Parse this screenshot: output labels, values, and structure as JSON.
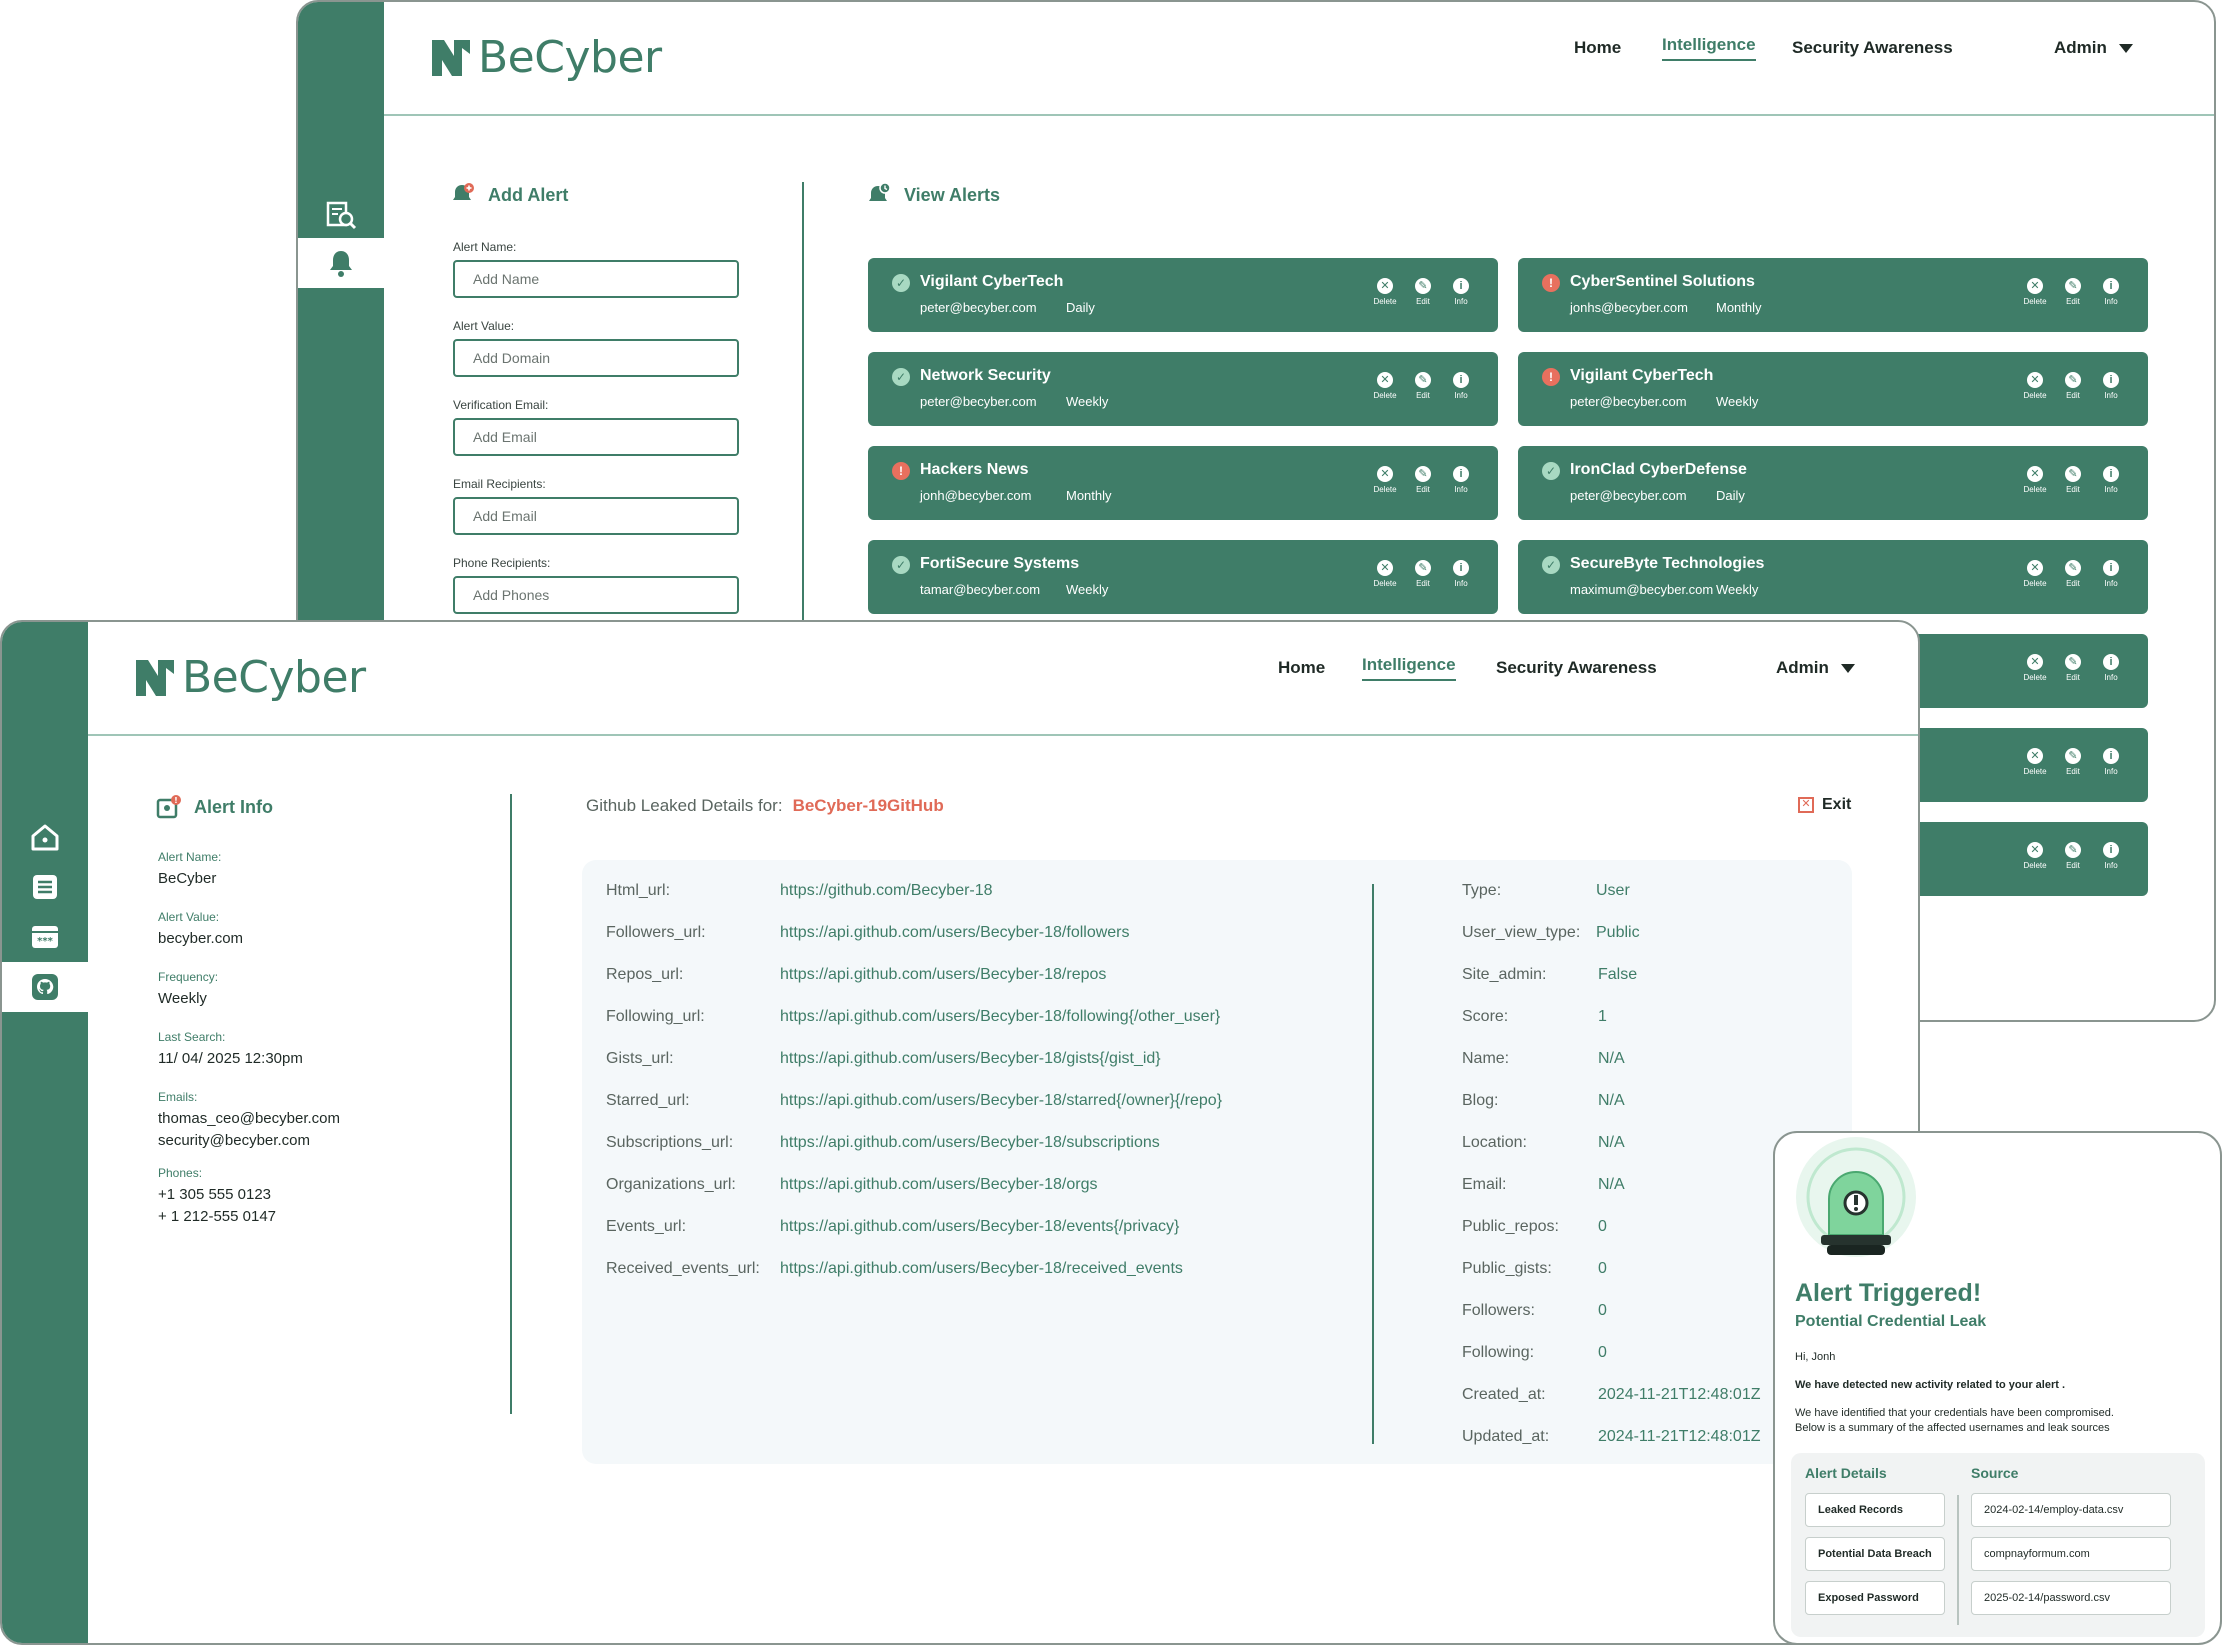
{
  "brand": {
    "logo_text": "BeCyber",
    "color_primary": "#3f7d68",
    "color_alert": "#e06a57"
  },
  "nav": {
    "home": "Home",
    "intelligence": "Intelligence",
    "security_awareness": "Security Awareness",
    "admin": "Admin"
  },
  "add_alert": {
    "title": "Add Alert",
    "fields": [
      {
        "label": "Alert Name:",
        "placeholder": "Add Name"
      },
      {
        "label": "Alert Value:",
        "placeholder": "Add Domain"
      },
      {
        "label": "Verification Email:",
        "placeholder": "Add Email"
      },
      {
        "label": "Email Recipients:",
        "placeholder": "Add Email"
      },
      {
        "label": "Phone Recipients:",
        "placeholder": "Add Phones"
      }
    ]
  },
  "view_alerts": {
    "title": "View Alerts",
    "action_labels": {
      "delete": "Delete",
      "edit": "Edit",
      "info": "Info"
    },
    "cards": [
      {
        "name": "Vigilant CyberTech",
        "email": "peter@becyber.com",
        "freq": "Daily",
        "status": "ok"
      },
      {
        "name": "CyberSentinel Solutions",
        "email": "jonhs@becyber.com",
        "freq": "Monthly",
        "status": "warn"
      },
      {
        "name": "Network Security",
        "email": "peter@becyber.com",
        "freq": "Weekly",
        "status": "ok"
      },
      {
        "name": "Vigilant CyberTech",
        "email": "peter@becyber.com",
        "freq": "Weekly",
        "status": "warn"
      },
      {
        "name": "Hackers News",
        "email": "jonh@becyber.com",
        "freq": "Monthly",
        "status": "warn"
      },
      {
        "name": "IronClad CyberDefense",
        "email": "peter@becyber.com",
        "freq": "Daily",
        "status": "ok"
      },
      {
        "name": "FortiSecure Systems",
        "email": "tamar@becyber.com",
        "freq": "Weekly",
        "status": "ok"
      },
      {
        "name": "SecureByte Technologies",
        "email": "maximum@becyber.com",
        "freq": "Weekly",
        "status": "ok"
      }
    ]
  },
  "alert_info": {
    "title": "Alert Info",
    "name_label": "Alert Name:",
    "name": "BeCyber",
    "value_label": "Alert Value:",
    "value": "becyber.com",
    "freq_label": "Frequency:",
    "freq": "Weekly",
    "last_label": "Last Search:",
    "last": "11/ 04/ 2025 12:30pm",
    "emails_label": "Emails:",
    "email1": "thomas_ceo@becyber.com",
    "email2": "security@becyber.com",
    "phones_label": "Phones:",
    "phone1": "+1 305 555 0123",
    "phone2": "+ 1 212-555 0147"
  },
  "github": {
    "header": "Github Leaked Details for:",
    "target": "BeCyber-19GitHub",
    "exit": "Exit",
    "left": [
      {
        "k": "Html_url:",
        "v": "https://github.com/Becyber-18"
      },
      {
        "k": "Followers_url:",
        "v": "https://api.github.com/users/Becyber-18/followers"
      },
      {
        "k": "Repos_url:",
        "v": "https://api.github.com/users/Becyber-18/repos"
      },
      {
        "k": "Following_url:",
        "v": "https://api.github.com/users/Becyber-18/following{/other_user}"
      },
      {
        "k": "Gists_url:",
        "v": "https://api.github.com/users/Becyber-18/gists{/gist_id}"
      },
      {
        "k": "Starred_url:",
        "v": "https://api.github.com/users/Becyber-18/starred{/owner}{/repo}"
      },
      {
        "k": "Subscriptions_url:",
        "v": "https://api.github.com/users/Becyber-18/subscriptions"
      },
      {
        "k": "Organizations_url:",
        "v": "https://api.github.com/users/Becyber-18/orgs"
      },
      {
        "k": "Events_url:",
        "v": "https://api.github.com/users/Becyber-18/events{/privacy}"
      },
      {
        "k": "Received_events_url:",
        "v": "https://api.github.com/users/Becyber-18/received_events"
      }
    ],
    "right": [
      {
        "k": "Type:",
        "v": "User"
      },
      {
        "k": "User_view_type:",
        "v": "Public"
      },
      {
        "k": "Site_admin:",
        "v": "False"
      },
      {
        "k": "Score:",
        "v": "1"
      },
      {
        "k": "Name:",
        "v": "N/A"
      },
      {
        "k": "Blog:",
        "v": "N/A"
      },
      {
        "k": "Location:",
        "v": "N/A"
      },
      {
        "k": "Email:",
        "v": "N/A"
      },
      {
        "k": "Public_repos:",
        "v": "0"
      },
      {
        "k": "Public_gists:",
        "v": "0"
      },
      {
        "k": "Followers:",
        "v": "0"
      },
      {
        "k": "Following:",
        "v": "0"
      },
      {
        "k": "Created_at:",
        "v": "2024-11-21T12:48:01Z"
      },
      {
        "k": "Updated_at:",
        "v": "2024-11-21T12:48:01Z"
      }
    ]
  },
  "popup": {
    "title": "Alert Triggered!",
    "subtitle": "Potential Credential Leak",
    "greeting": "Hi, Jonh",
    "bold_line": "We have detected new activity related to your alert .",
    "body1": "We have identified that your credentials have been compromised.",
    "body2": "Below is a summary of the affected usernames and leak sources",
    "details_header": "Alert Details",
    "source_header": "Source",
    "details": [
      "Leaked Records",
      "Potential Data Breach",
      "Exposed Password"
    ],
    "sources": [
      "2024-02-14/employ-data.csv",
      "compnayformum.com",
      "2025-02-14/password.csv"
    ]
  }
}
